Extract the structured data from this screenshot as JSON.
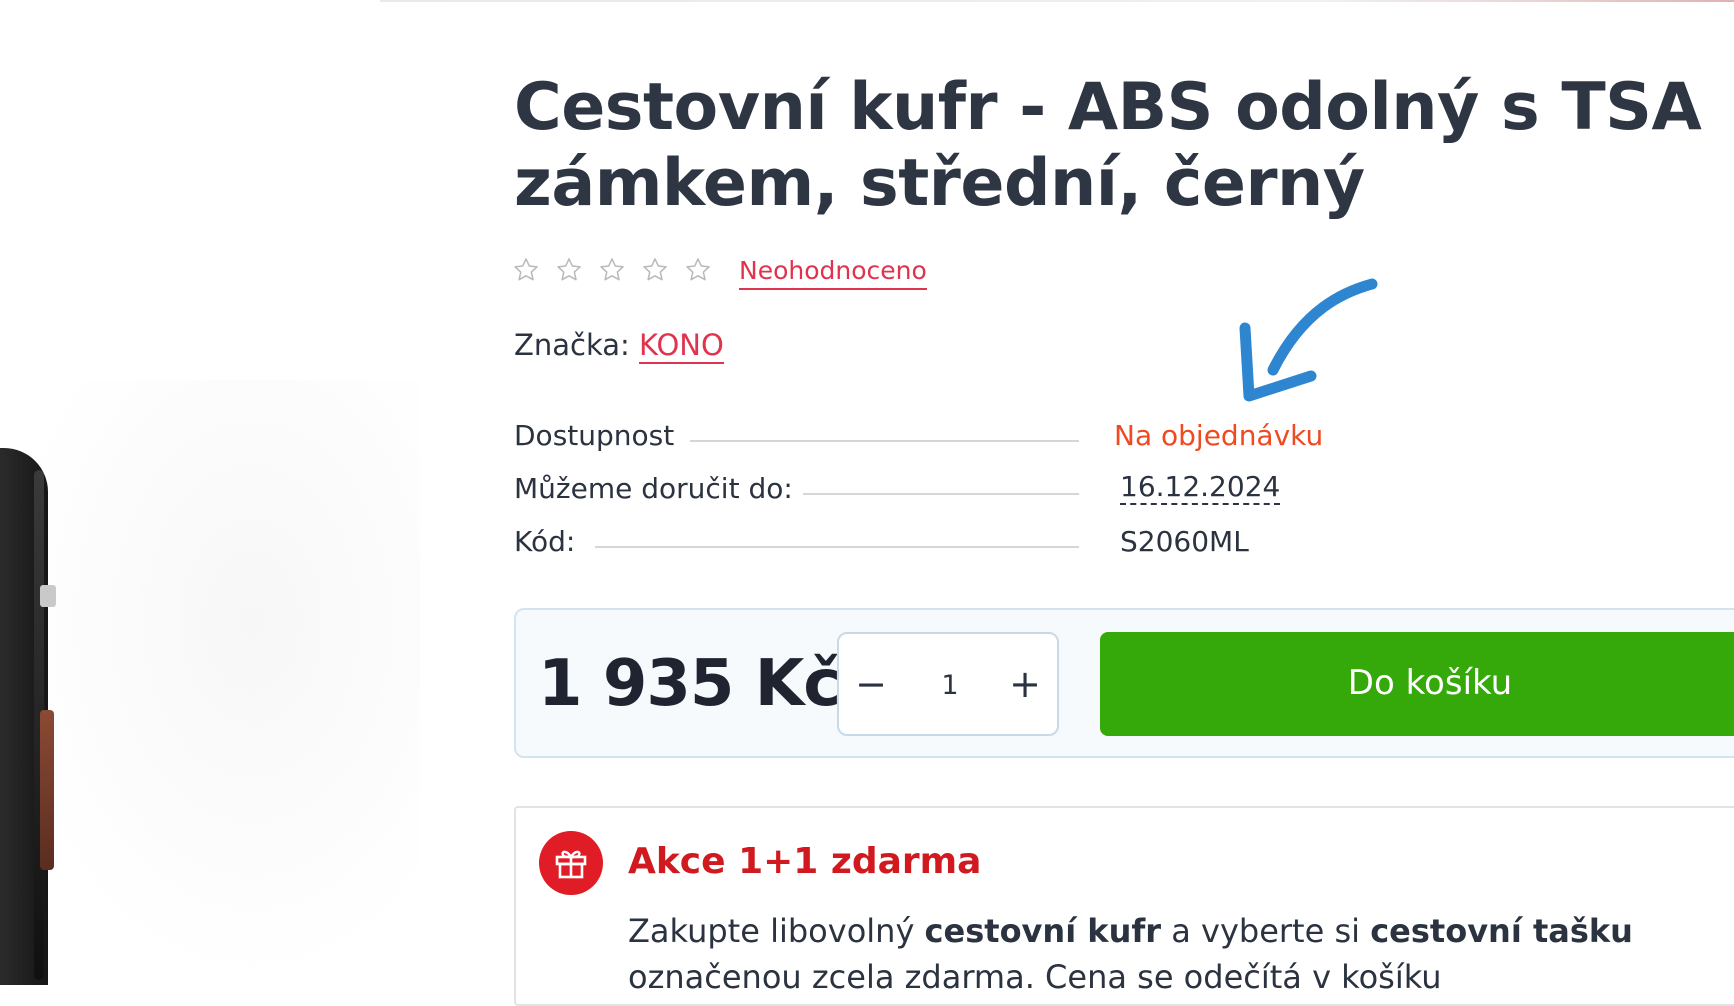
{
  "product": {
    "title": "Cestovní kufr - ABS odolný s TSA zámkem, střední, černý",
    "rating": {
      "stars_filled": 0,
      "stars_total": 5,
      "label": "Neohodnoceno"
    },
    "brand": {
      "label": "Značka:",
      "name": "KONO"
    }
  },
  "specs": {
    "availability": {
      "label": "Dostupnost",
      "value": "Na objednávku"
    },
    "delivery": {
      "label": "Můžeme doručit do:",
      "value": "16.12.2024"
    },
    "code": {
      "label": "Kód:",
      "value": "S2060ML"
    }
  },
  "buy": {
    "price": "1 935 Kč",
    "quantity": "1",
    "minus_symbol": "−",
    "plus_symbol": "+",
    "add_to_cart_label": "Do košíku"
  },
  "promo": {
    "title": "Akce 1+1 zdarma",
    "text_part1": "Zakupte libovolný ",
    "text_bold1": "cestovní kufr",
    "text_part2": " a vyberte si ",
    "text_bold2": "cestovní tašku",
    "text_part3": " označenou zcela zdarma. Cena se odečítá v košíku"
  },
  "icons": {
    "star": "star-outline-icon",
    "gift": "gift-icon",
    "arrow": "annotation-arrow-icon"
  },
  "colors": {
    "accent_link": "#e0334d",
    "availability": "#ef4a21",
    "cart_button": "#35a80a",
    "promo_red": "#d11920",
    "arrow_blue": "#2f86d0"
  }
}
